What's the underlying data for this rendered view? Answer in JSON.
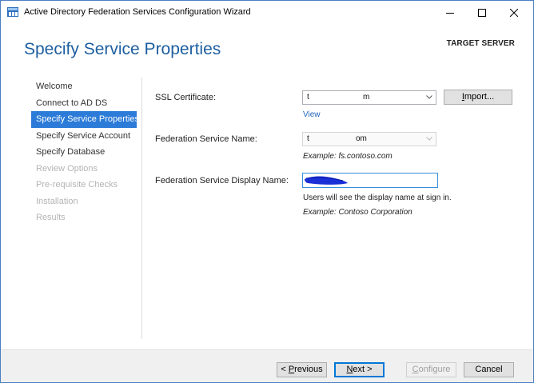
{
  "window": {
    "title": "Active Directory Federation Services Configuration Wizard"
  },
  "header": {
    "page_title": "Specify Service Properties",
    "target_server_label": "TARGET SERVER"
  },
  "nav": {
    "items": [
      {
        "label": "Welcome",
        "state": "normal"
      },
      {
        "label": "Connect to AD DS",
        "state": "normal"
      },
      {
        "label": "Specify Service Properties",
        "state": "active"
      },
      {
        "label": "Specify Service Account",
        "state": "normal"
      },
      {
        "label": "Specify Database",
        "state": "normal"
      },
      {
        "label": "Review Options",
        "state": "disabled"
      },
      {
        "label": "Pre-requisite Checks",
        "state": "disabled"
      },
      {
        "label": "Installation",
        "state": "disabled"
      },
      {
        "label": "Results",
        "state": "disabled"
      }
    ]
  },
  "form": {
    "ssl": {
      "label": "SSL Certificate:",
      "value_start": "t",
      "value_end": "m",
      "import_label": "Import...",
      "view_link": "View"
    },
    "fs_name": {
      "label": "Federation Service Name:",
      "value_start": "t",
      "value_end": "om",
      "example": "Example: fs.contoso.com"
    },
    "display_name": {
      "label": "Federation Service Display Name:",
      "value": "",
      "help": "Users will see the display name at sign in.",
      "example": "Example: Contoso Corporation"
    }
  },
  "footer": {
    "previous_label": "< Previous",
    "next_label": "Next >",
    "configure_label": "Configure",
    "cancel_label": "Cancel"
  },
  "colors": {
    "accent": "#2c7bd8",
    "title": "#1e5fa0",
    "link": "#1c63b7",
    "redaction": "#1a2fd6"
  }
}
